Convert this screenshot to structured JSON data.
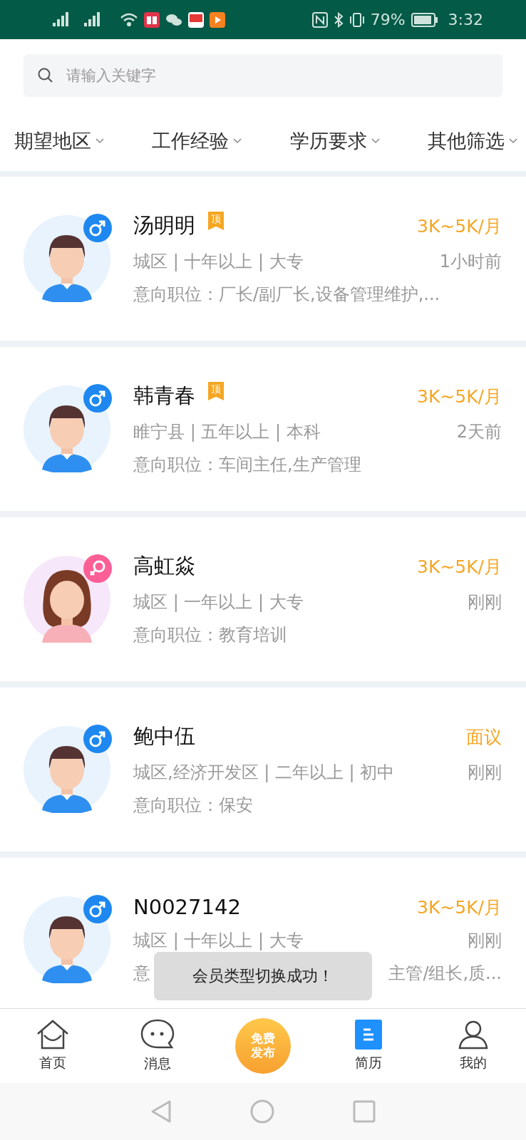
{
  "status_bar": {
    "battery_text": "79%",
    "time": "3:32"
  },
  "search": {
    "placeholder": "请输入关键字"
  },
  "filters": [
    {
      "label": "期望地区"
    },
    {
      "label": "工作经验"
    },
    {
      "label": "学历要求"
    },
    {
      "label": "其他筛选"
    }
  ],
  "candidates": [
    {
      "name": "汤明明",
      "kind": "male",
      "badge": "顶",
      "salary": "3K~5K/月",
      "info": "城区 | 十年以上 | 大专",
      "time": "1小时前",
      "position": "意向职位：厂长/副厂长,设备管理维护,..."
    },
    {
      "name": "韩青春",
      "kind": "male",
      "badge": "顶",
      "salary": "3K~5K/月",
      "info": "睢宁县 | 五年以上 | 本科",
      "time": "2天前",
      "position": "意向职位：车间主任,生产管理"
    },
    {
      "name": "高虹焱",
      "kind": "female",
      "salary": "3K~5K/月",
      "info": "城区 | 一年以上 | 大专",
      "time": "刚刚",
      "position": "意向职位：教育培训"
    },
    {
      "name": "鲍中伍",
      "kind": "male",
      "salary": "面议",
      "info": "城区,经济开发区 | 二年以上 | 初中",
      "time": "刚刚",
      "position": "意向职位：保安"
    },
    {
      "name": "N0027142",
      "kind": "male",
      "salary": "3K~5K/月",
      "info": "城区 | 十年以上 | 大专",
      "time": "刚刚",
      "position_parts": [
        "意",
        "主管/组长,质..."
      ]
    }
  ],
  "toast": "会员类型切换成功！",
  "tab_bar": [
    {
      "kind": "home",
      "label": "首页",
      "selected": false
    },
    {
      "kind": "messages",
      "label": "消息",
      "selected": false
    },
    {
      "kind": "publish",
      "label": "免费发布",
      "selected": false
    },
    {
      "kind": "resume",
      "label": "简历",
      "selected": true
    },
    {
      "kind": "profile",
      "label": "我的",
      "selected": false
    }
  ]
}
